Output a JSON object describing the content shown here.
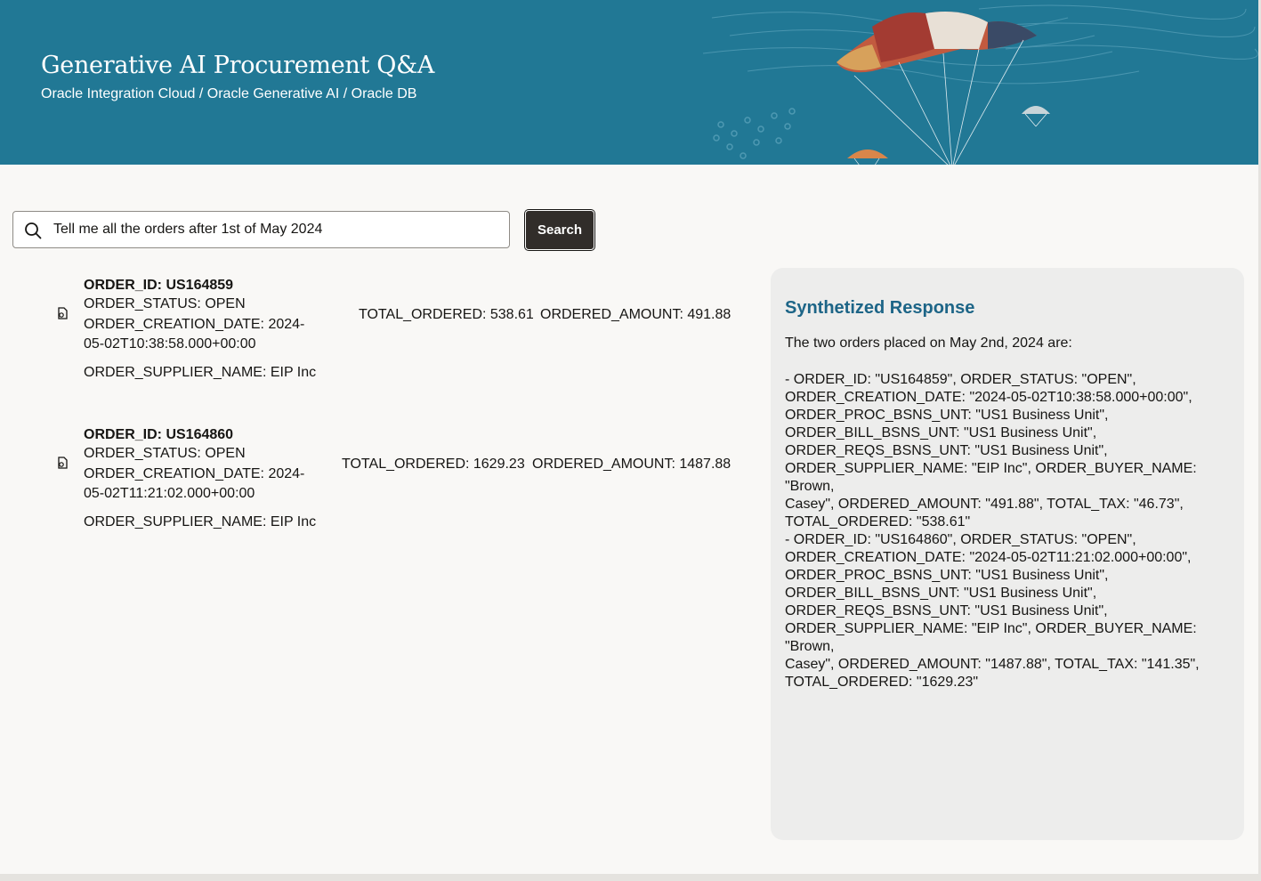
{
  "header": {
    "title": "Generative AI Procurement Q&A",
    "subtitle": "Oracle Integration Cloud / Oracle Generative AI / Oracle DB"
  },
  "search": {
    "value": "Tell me all the orders after 1st of May 2024",
    "button_label": "Search"
  },
  "results": [
    {
      "order_id": "ORDER_ID: US164859",
      "status": "ORDER_STATUS: OPEN",
      "creation_date": "ORDER_CREATION_DATE: 2024-05-02T10:38:58.000+00:00",
      "supplier": "ORDER_SUPPLIER_NAME: EIP Inc",
      "total_ordered": "TOTAL_ORDERED: 538.61",
      "ordered_amount": "ORDERED_AMOUNT: 491.88"
    },
    {
      "order_id": "ORDER_ID: US164860",
      "status": "ORDER_STATUS: OPEN",
      "creation_date": "ORDER_CREATION_DATE: 2024-05-02T11:21:02.000+00:00",
      "supplier": "ORDER_SUPPLIER_NAME: EIP Inc",
      "total_ordered": "TOTAL_ORDERED: 1629.23",
      "ordered_amount": "ORDERED_AMOUNT: 1487.88"
    }
  ],
  "response": {
    "title": "Synthetized Response",
    "intro": "The two orders placed on May 2nd, 2024 are:",
    "body": "- ORDER_ID: \"US164859\", ORDER_STATUS: \"OPEN\",\nORDER_CREATION_DATE: \"2024-05-02T10:38:58.000+00:00\",\nORDER_PROC_BSNS_UNT: \"US1 Business Unit\",\nORDER_BILL_BSNS_UNT: \"US1 Business Unit\",\nORDER_REQS_BSNS_UNT: \"US1 Business Unit\",\nORDER_SUPPLIER_NAME: \"EIP Inc\", ORDER_BUYER_NAME: \"Brown,\nCasey\", ORDERED_AMOUNT: \"491.88\", TOTAL_TAX: \"46.73\",\nTOTAL_ORDERED: \"538.61\"\n- ORDER_ID: \"US164860\", ORDER_STATUS: \"OPEN\",\nORDER_CREATION_DATE: \"2024-05-02T11:21:02.000+00:00\",\nORDER_PROC_BSNS_UNT: \"US1 Business Unit\",\nORDER_BILL_BSNS_UNT: \"US1 Business Unit\",\nORDER_REQS_BSNS_UNT: \"US1 Business Unit\",\nORDER_SUPPLIER_NAME: \"EIP Inc\", ORDER_BUYER_NAME: \"Brown,\nCasey\", ORDERED_AMOUNT: \"1487.88\", TOTAL_TAX: \"141.35\",\nTOTAL_ORDERED: \"1629.23\""
  },
  "colors": {
    "header_bg": "#217895",
    "button_bg": "#312d2a",
    "panel_bg": "#ededec",
    "panel_title": "#1d6587"
  }
}
